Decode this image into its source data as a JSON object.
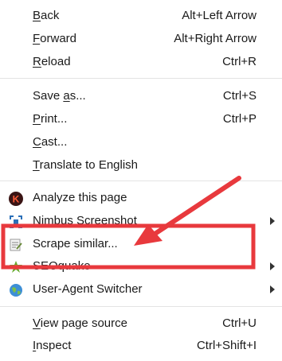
{
  "menu": {
    "back": {
      "mnemonic": "B",
      "rest": "ack",
      "shortcut": "Alt+Left Arrow"
    },
    "forward": {
      "mnemonic": "F",
      "rest": "orward",
      "shortcut": "Alt+Right Arrow"
    },
    "reload": {
      "mnemonic": "R",
      "rest": "eload",
      "shortcut": "Ctrl+R"
    },
    "save_as": {
      "pre": "Save ",
      "mnemonic": "a",
      "rest": "s...",
      "shortcut": "Ctrl+S"
    },
    "print": {
      "mnemonic": "P",
      "rest": "rint...",
      "shortcut": "Ctrl+P"
    },
    "cast": {
      "mnemonic": "C",
      "rest": "ast..."
    },
    "translate": {
      "mnemonic": "T",
      "rest": "ranslate to English"
    },
    "analyze": {
      "label": "Analyze this page",
      "icon": "k-logo-icon"
    },
    "nimbus": {
      "label": "Nimbus Screenshot",
      "icon": "nimbus-screenshot-icon"
    },
    "scrape": {
      "label": "Scrape similar...",
      "icon": "scraper-icon"
    },
    "seoquake": {
      "label": "SEOquake",
      "icon": "seoquake-icon"
    },
    "user_agent": {
      "label": "User-Agent Switcher",
      "icon": "globe-icon"
    },
    "view_source": {
      "mnemonic": "V",
      "rest": "iew page source",
      "shortcut": "Ctrl+U"
    },
    "inspect": {
      "mnemonic": "I",
      "rest": "nspect",
      "shortcut": "Ctrl+Shift+I"
    }
  },
  "colors": {
    "highlight_box": "#e8393d",
    "arrow": "#e8393d"
  }
}
